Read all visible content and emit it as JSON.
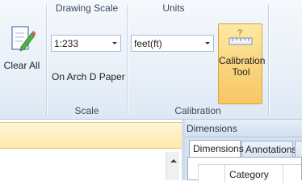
{
  "ribbon": {
    "clear_all": {
      "label": "Clear All",
      "icon": "document-pencil-icon"
    },
    "scale_group": {
      "title": "Drawing Scale",
      "combo_value": "1:233",
      "paper_text": "On Arch D Paper",
      "group_label": "Scale"
    },
    "calibration_group": {
      "title": "Units",
      "combo_value": "feet(ft)",
      "group_label": "Calibration",
      "tool_label_line1": "Calibration",
      "tool_label_line2": "Tool",
      "tool_icon": "ruler-question-icon"
    }
  },
  "dimensions_panel": {
    "title": "Dimensions",
    "tabs": [
      {
        "label": "Dimensions",
        "active": true
      },
      {
        "label": "Annotations",
        "active": false
      }
    ],
    "grid_columns": [
      "Category"
    ]
  },
  "colors": {
    "ribbon_bg": "#e9f0f8",
    "highlight": "#f9d27a",
    "panel_bg": "#d6e2f1"
  }
}
